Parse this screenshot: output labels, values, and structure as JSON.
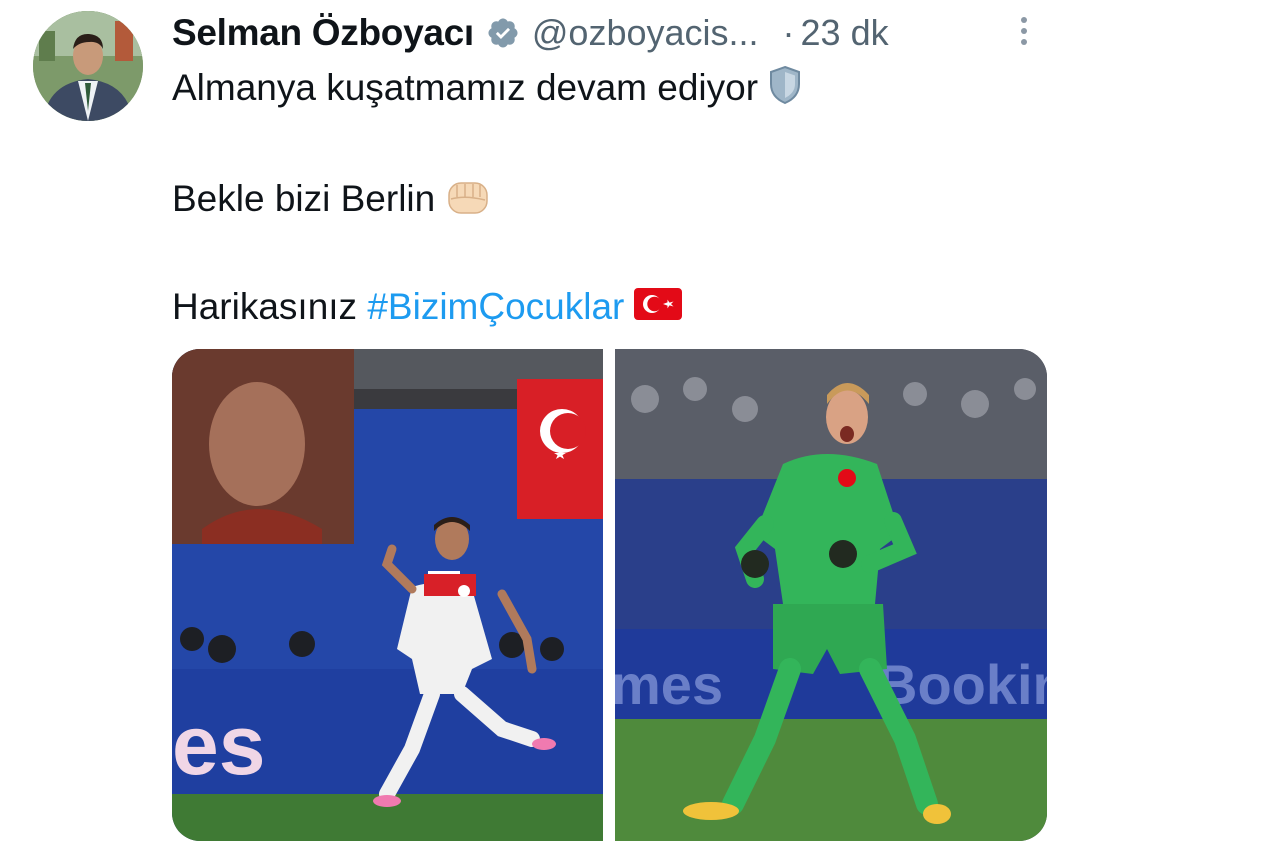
{
  "tweet": {
    "author_name": "Selman Özboyacı",
    "handle": "@ozboyacis...",
    "separator": "·",
    "time": "23 dk",
    "lines": [
      "Almanya kuşatmamız devam ediyor",
      "Bekle bizi Berlin",
      "Harikasınız "
    ],
    "hashtag": "#BizimÇocuklar"
  },
  "icons": {
    "verified": "verified-badge-icon",
    "more": "more-vertical-icon",
    "shield": "shield-emoji",
    "fist": "fist-emoji",
    "flag": "turkey-flag-emoji"
  },
  "photos": {
    "left_banner_text": "es",
    "right_banner_text_1": "mes",
    "right_banner_text_2": "Booking"
  },
  "colors": {
    "text": "#0f1419",
    "secondary": "#536471",
    "hashtag": "#1d9bf0",
    "verified": "#829aab"
  }
}
